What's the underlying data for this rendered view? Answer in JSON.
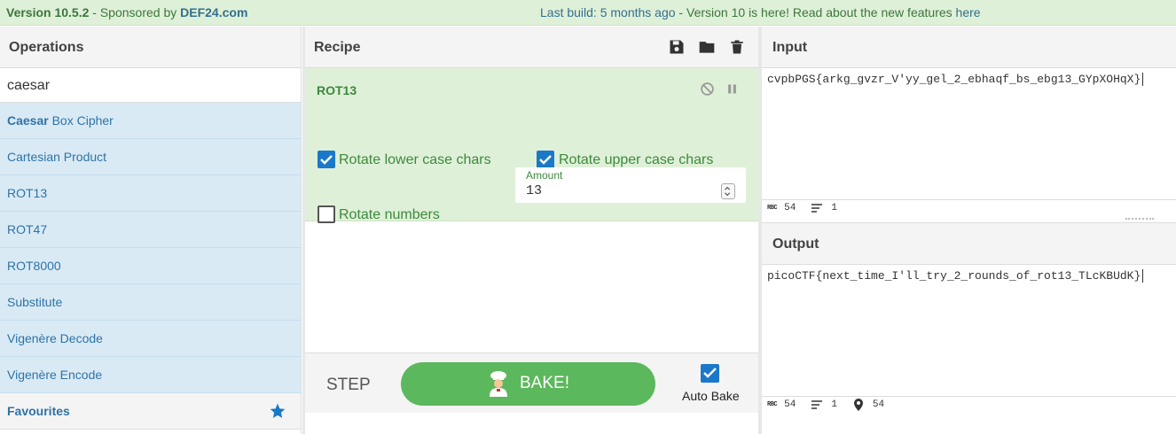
{
  "banner": {
    "version": "Version 10.5.2",
    "sponsored_prefix": " - Sponsored by ",
    "sponsor": "DEF24.com",
    "last_build": "Last build: 5 months ago",
    "separator": " - ",
    "announcement": "Version 10 is here! Read about the new features ",
    "link": "here"
  },
  "operations": {
    "title": "Operations",
    "search_value": "caesar",
    "items": [
      {
        "bold": "Caesar",
        "rest": " Box Cipher"
      },
      {
        "bold": "",
        "rest": "Cartesian Product"
      },
      {
        "bold": "",
        "rest": "ROT13"
      },
      {
        "bold": "",
        "rest": "ROT47"
      },
      {
        "bold": "",
        "rest": "ROT8000"
      },
      {
        "bold": "",
        "rest": "Substitute"
      },
      {
        "bold": "",
        "rest": "Vigenère Decode"
      },
      {
        "bold": "",
        "rest": "Vigenère Encode"
      }
    ],
    "favourites": "Favourites"
  },
  "recipe": {
    "title": "Recipe",
    "operation": "ROT13",
    "rotate_lower": "Rotate lower case chars",
    "rotate_upper": "Rotate upper case chars",
    "rotate_numbers": "Rotate numbers",
    "amount_label": "Amount",
    "amount_value": "13",
    "step": "STEP",
    "bake": "BAKE!",
    "auto_bake": "Auto Bake"
  },
  "input": {
    "title": "Input",
    "text": "cvpbPGS{arkg_gvzr_V'yy_gel_2_ebhaqf_bs_ebg13_GYpXOHqX}",
    "chars": "54",
    "lines": "1"
  },
  "output": {
    "title": "Output",
    "text": "picoCTF{next_time_I'll_try_2_rounds_of_rot13_TLcKBUdK}",
    "chars": "54",
    "lines": "1",
    "position": "54"
  },
  "colors": {
    "accent": "#1b78c9",
    "bake": "#5cb85c",
    "recipe_bg": "#dff0d8",
    "op_bg": "#d9eaf5"
  }
}
